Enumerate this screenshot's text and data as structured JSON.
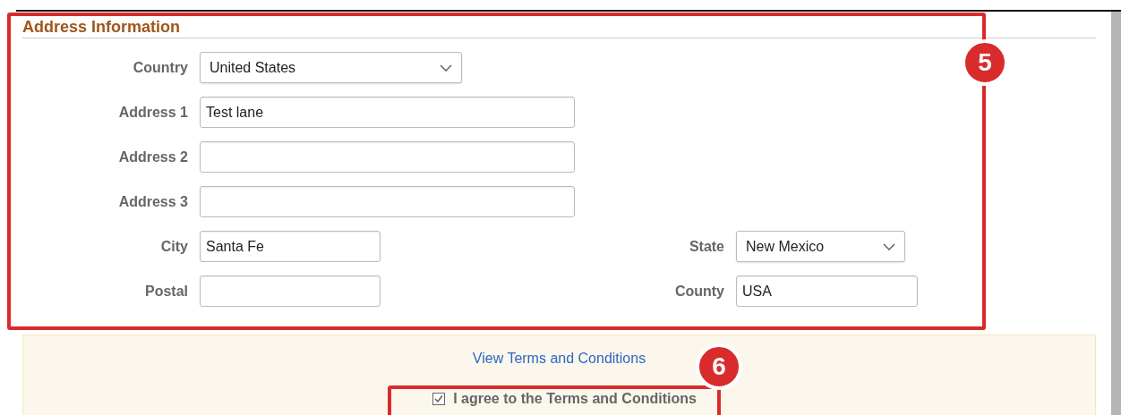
{
  "section": {
    "title": "Address Information"
  },
  "rows": [
    {
      "fields": [
        {
          "label": "Country",
          "kind": "select",
          "value": "United States"
        }
      ]
    },
    {
      "fields": [
        {
          "label": "Address 1",
          "kind": "text",
          "value": "Test lane"
        }
      ]
    },
    {
      "fields": [
        {
          "label": "Address 2",
          "kind": "text"
        }
      ]
    },
    {
      "fields": [
        {
          "label": "Address 3",
          "kind": "text"
        }
      ]
    },
    {
      "fields": [
        {
          "label": "City",
          "kind": "text",
          "value": "Santa Fe"
        },
        {
          "label": "State",
          "kind": "select",
          "value": "New Mexico"
        }
      ]
    },
    {
      "fields": [
        {
          "label": "Postal",
          "kind": "text"
        },
        {
          "label": "County",
          "kind": "text",
          "value": "USA"
        }
      ]
    }
  ],
  "terms": {
    "link": "View Terms and Conditions",
    "agree": {
      "label": "I agree to the Terms and Conditions",
      "checked": true
    }
  },
  "callouts": [
    {
      "number": "5"
    },
    {
      "number": "6"
    }
  ]
}
